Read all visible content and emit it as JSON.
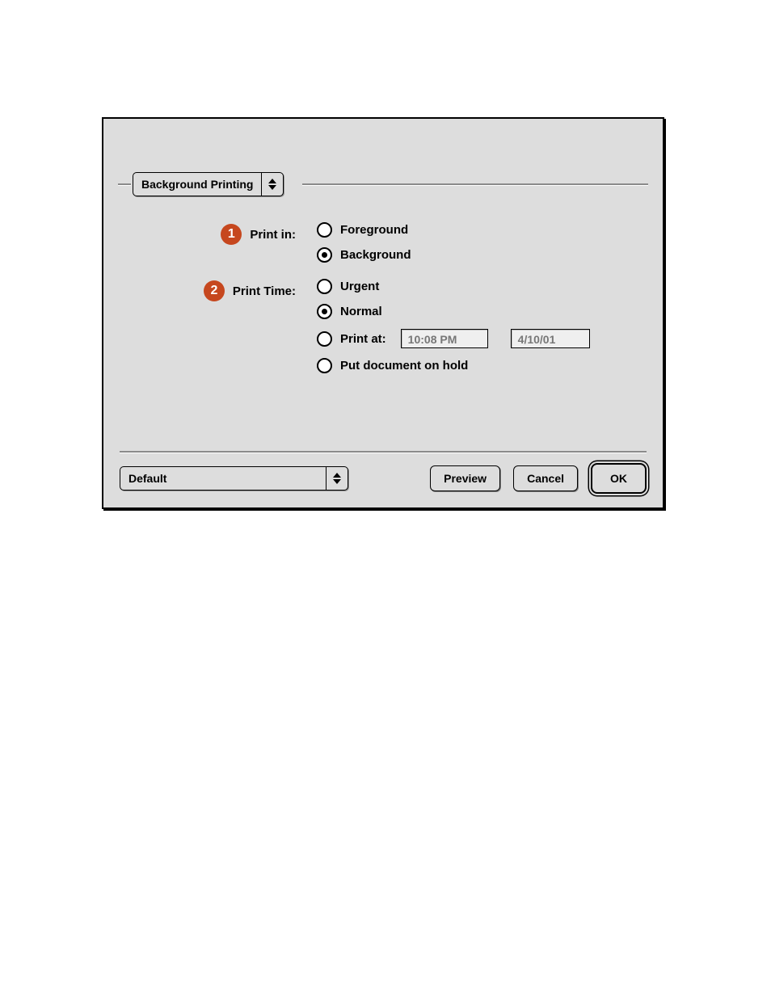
{
  "panel_selector": {
    "value": "Background Printing"
  },
  "callouts": {
    "print_in": "1",
    "print_time": "2"
  },
  "labels": {
    "print_in": "Print in:",
    "print_time": "Print Time:"
  },
  "print_in": {
    "options": {
      "foreground": "Foreground",
      "background": "Background"
    },
    "selected": "background"
  },
  "print_time": {
    "options": {
      "urgent": "Urgent",
      "normal": "Normal",
      "print_at": "Print at:",
      "hold": "Put document on hold"
    },
    "selected": "normal",
    "time_value": "10:08 PM",
    "date_value": "4/10/01"
  },
  "settings_popup": {
    "value": "Default"
  },
  "buttons": {
    "preview": "Preview",
    "cancel": "Cancel",
    "ok": "OK"
  }
}
